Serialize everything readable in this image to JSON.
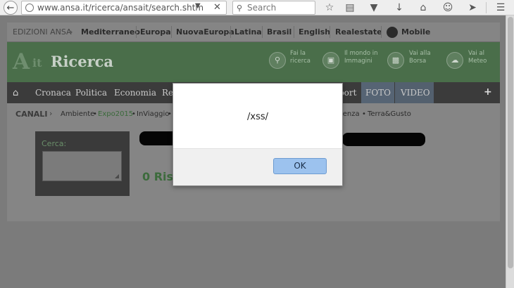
{
  "browser": {
    "url": "www.ansa.it/ricerca/ansait/search.shtm",
    "search_placeholder": "Search"
  },
  "edition_bar": {
    "label": "EDIZIONI ANSA",
    "items": [
      "Mediterraneo",
      "Europa",
      "NuovaEuropa",
      "Latina",
      "Brasil",
      "English",
      "Realestate",
      "Mobile"
    ]
  },
  "header": {
    "logo_a": "A",
    "logo_it": "it",
    "title": "Ricerca",
    "links": [
      {
        "line1": "Fai la",
        "line2": "ricerca"
      },
      {
        "line1": "Il mondo in",
        "line2": "Immagini"
      },
      {
        "line1": "Vai alla",
        "line2": "Borsa"
      },
      {
        "line1": "Vai al",
        "line2": "Meteo"
      }
    ]
  },
  "nav": {
    "items": [
      "Cronaca",
      "Politica",
      "Economia",
      "Re"
    ],
    "items_right": [
      "port",
      "FOTO",
      "VIDEO"
    ],
    "plus": "+"
  },
  "channels": {
    "label": "CANALI",
    "items": [
      "Ambiente",
      "Expo2015",
      "InViaggio"
    ],
    "items_right": [
      "ienza",
      "Terra&Gusto"
    ]
  },
  "search_box": {
    "label": "Cerca:"
  },
  "results": {
    "text": "0 Risu"
  },
  "dialog": {
    "message": "/xss/",
    "ok_label": "OK"
  },
  "colors": {
    "dialog_button": "#9cc2ee",
    "header_green": "#4a6e4a"
  }
}
